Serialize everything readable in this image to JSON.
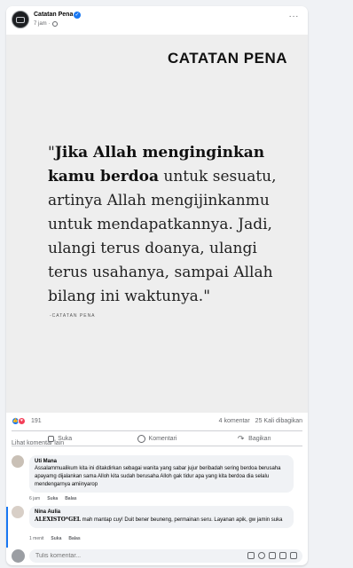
{
  "post": {
    "page_name": "Catatan Pena",
    "time": "7 jam",
    "dot": "·",
    "more_label": "···"
  },
  "image": {
    "brand": "CATATAN PENA",
    "quote_open": "\"",
    "quote_bold": "Jika Allah menginginkan kamu berdoa",
    "quote_rest": " untuk sesuatu, artinya Allah mengijinkanmu untuk mendapatkannya. Jadi, ulangi terus doanya, ulangi terus usahanya, sampai Allah bilang ini waktunya.\"",
    "quote_author": "-CATATAN PENA"
  },
  "stats": {
    "reactions": "191",
    "comments": "4 komentar",
    "shares": "25 Kali dibagikan"
  },
  "actions": {
    "like": "Suka",
    "comment": "Komentari",
    "share": "Bagikan"
  },
  "more_comments": "Lihat komentar lain",
  "comments": [
    {
      "name": "Uti Mana",
      "text": "Assalammualikum kita ini ditakdirkan sebagai wanita yang sabar jujur beribadah sering berdoa berusaha apayamg dijalankan sama Alloh kita sudah berusaha Alloh gak tidur apa yang kita berdoa dia selalu mendengarnya amiinyarop",
      "time": "6 jam",
      "like": "Suka",
      "reply": "Balas"
    },
    {
      "name": "Nina Aulia",
      "text_bold": "ALEXISTO*GEL",
      "text": " mah mantap cuy! Duit bener beuneng, permainan seru. Layanan apik, gw jamin suka",
      "time": "1 menit",
      "like": "Suka",
      "reply": "Balas"
    }
  ],
  "write": {
    "placeholder": "Tulis komentar..."
  }
}
